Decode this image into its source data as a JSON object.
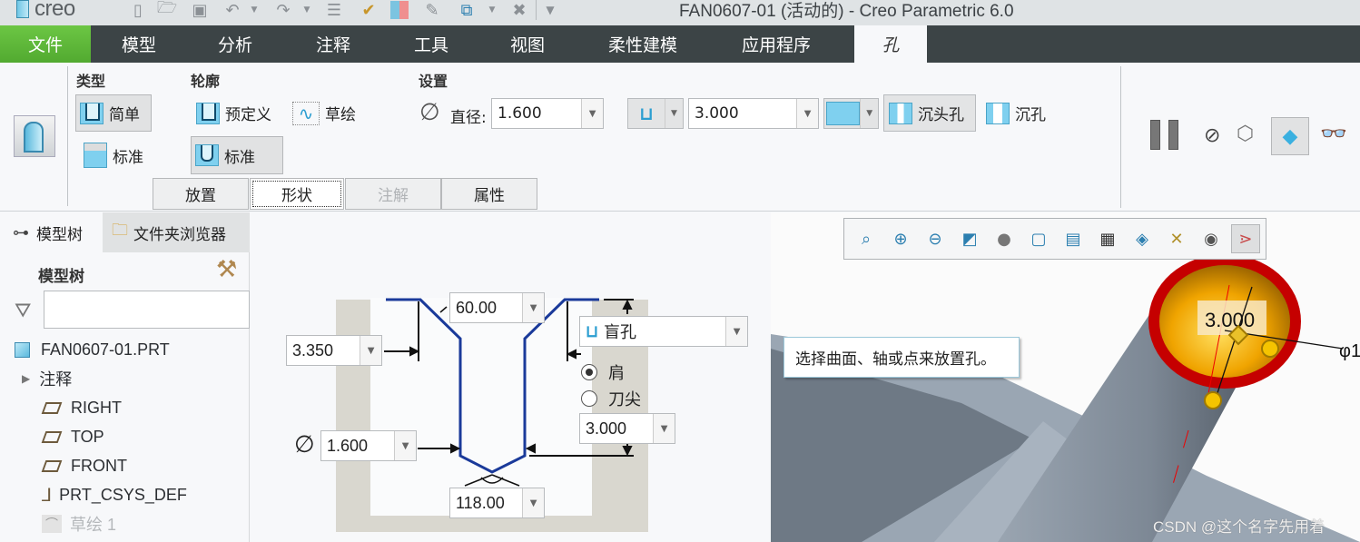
{
  "app": {
    "logo": "creo",
    "title": "FAN0607-01 (活动的) - Creo Parametric 6.0"
  },
  "quick_access": [
    "new-icon",
    "open-icon",
    "save-icon",
    "undo-icon",
    "redo-icon",
    "regenerate-icon",
    "regen-manager-icon",
    "windows-icon",
    "close-window-icon",
    "customize-icon"
  ],
  "ribbon_tabs": [
    {
      "label": "文件"
    },
    {
      "label": "模型"
    },
    {
      "label": "分析"
    },
    {
      "label": "注释"
    },
    {
      "label": "工具"
    },
    {
      "label": "视图"
    },
    {
      "label": "柔性建模"
    },
    {
      "label": "应用程序"
    },
    {
      "label": "孔"
    }
  ],
  "ribbon": {
    "type_group": {
      "title": "类型",
      "simple": "简单",
      "standard": "标准"
    },
    "profile_group": {
      "title": "轮廓",
      "predefined": "预定义",
      "sketch": "草绘",
      "standard": "标准"
    },
    "settings_group": {
      "title": "设置",
      "diameter_label": "直径:",
      "diameter_value": "1.600",
      "depth_value": "3.000",
      "countersink": "沉头孔",
      "counterbore": "沉孔"
    },
    "subtabs": [
      {
        "label": "放置",
        "state": "normal"
      },
      {
        "label": "形状",
        "state": "active"
      },
      {
        "label": "注解",
        "state": "disabled"
      },
      {
        "label": "属性",
        "state": "normal"
      }
    ],
    "right_controls": [
      "pause-icon",
      "no-preview-icon",
      "verify-icon",
      "preview-icon",
      "glasses-icon"
    ]
  },
  "left_panel": {
    "tabs": [
      {
        "label": "模型树"
      },
      {
        "label": "文件夹浏览器"
      }
    ],
    "header": "模型树",
    "filter_placeholder": "",
    "items": [
      {
        "label": "FAN0607-01.PRT",
        "icon": "part-icon"
      },
      {
        "label": "注释",
        "icon": "expand-icon"
      },
      {
        "label": "RIGHT",
        "icon": "datum-plane-icon"
      },
      {
        "label": "TOP",
        "icon": "datum-plane-icon"
      },
      {
        "label": "FRONT",
        "icon": "datum-plane-icon"
      },
      {
        "label": "PRT_CSYS_DEF",
        "icon": "csys-icon"
      },
      {
        "label": "草绘 1",
        "icon": "sketch-icon"
      }
    ]
  },
  "shape_panel": {
    "top_angle": "60.00",
    "shoulder_depth": "3.350",
    "diameter": "1.600",
    "tip_angle": "118.00",
    "depth_type": "盲孔",
    "radio_shoulder": "肩",
    "radio_tip": "刀尖",
    "radio_selected": "肩",
    "depth": "3.000"
  },
  "graphics": {
    "tooltip": "选择曲面、轴或点来放置孔。",
    "dim_label": "3.000",
    "dia_label": "φ1",
    "watermark": "CSDN @这个名字先用着",
    "view_toolbar": [
      "refit-icon",
      "zoom-in-icon",
      "zoom-out-icon",
      "repaint-icon",
      "display-style-icon",
      "saved-orientations-icon",
      "view-manager-icon",
      "perspective-icon",
      "section-icon",
      "datum-display-icon",
      "annotation-display-icon",
      "spin-center-icon"
    ]
  }
}
